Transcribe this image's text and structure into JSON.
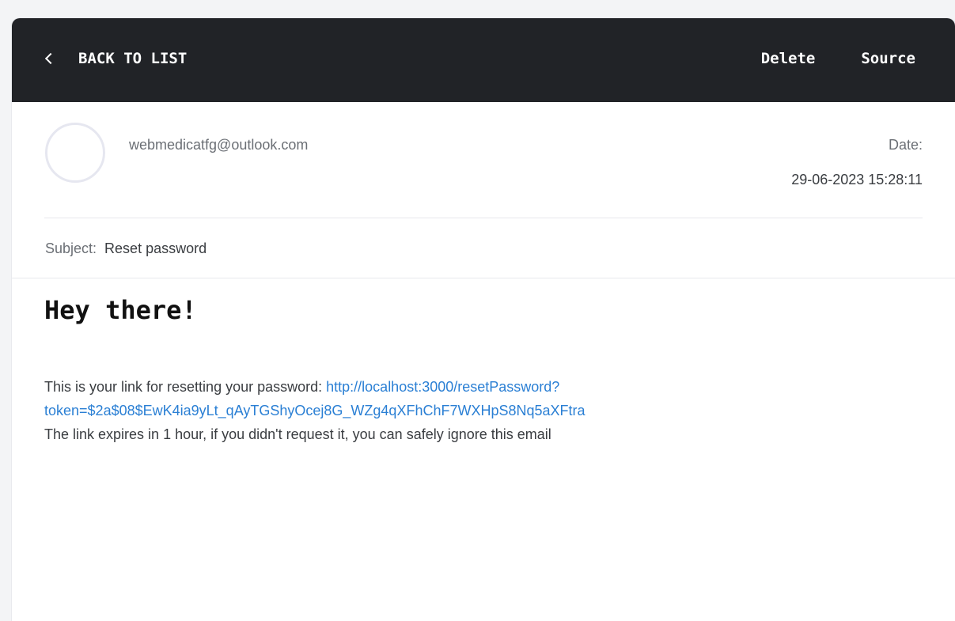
{
  "header": {
    "back_label": "BACK TO LIST",
    "delete_label": "Delete",
    "source_label": "Source"
  },
  "message": {
    "sender": "webmedicatfg@outlook.com",
    "date_label": "Date:",
    "date_value": "29-06-2023 15:28:11",
    "subject_label": "Subject:",
    "subject_value": "Reset password"
  },
  "content": {
    "greeting": "Hey there!",
    "intro": "This is your link for resetting your password: ",
    "link_line1": "http://localhost:3000/resetPassword?",
    "link_line2": "token=$2a$08$EwK4ia9yLt_qAyTGShyOcej8G_WZg4qXFhChF7WXHpS8Nq5aXFtra",
    "expiry": "The link expires in 1 hour, if you didn't request it, you can safely ignore this email"
  },
  "colors": {
    "topbar": "#212327",
    "link": "#2a7fd4"
  },
  "icons": {
    "back": "chevron-left-icon"
  }
}
